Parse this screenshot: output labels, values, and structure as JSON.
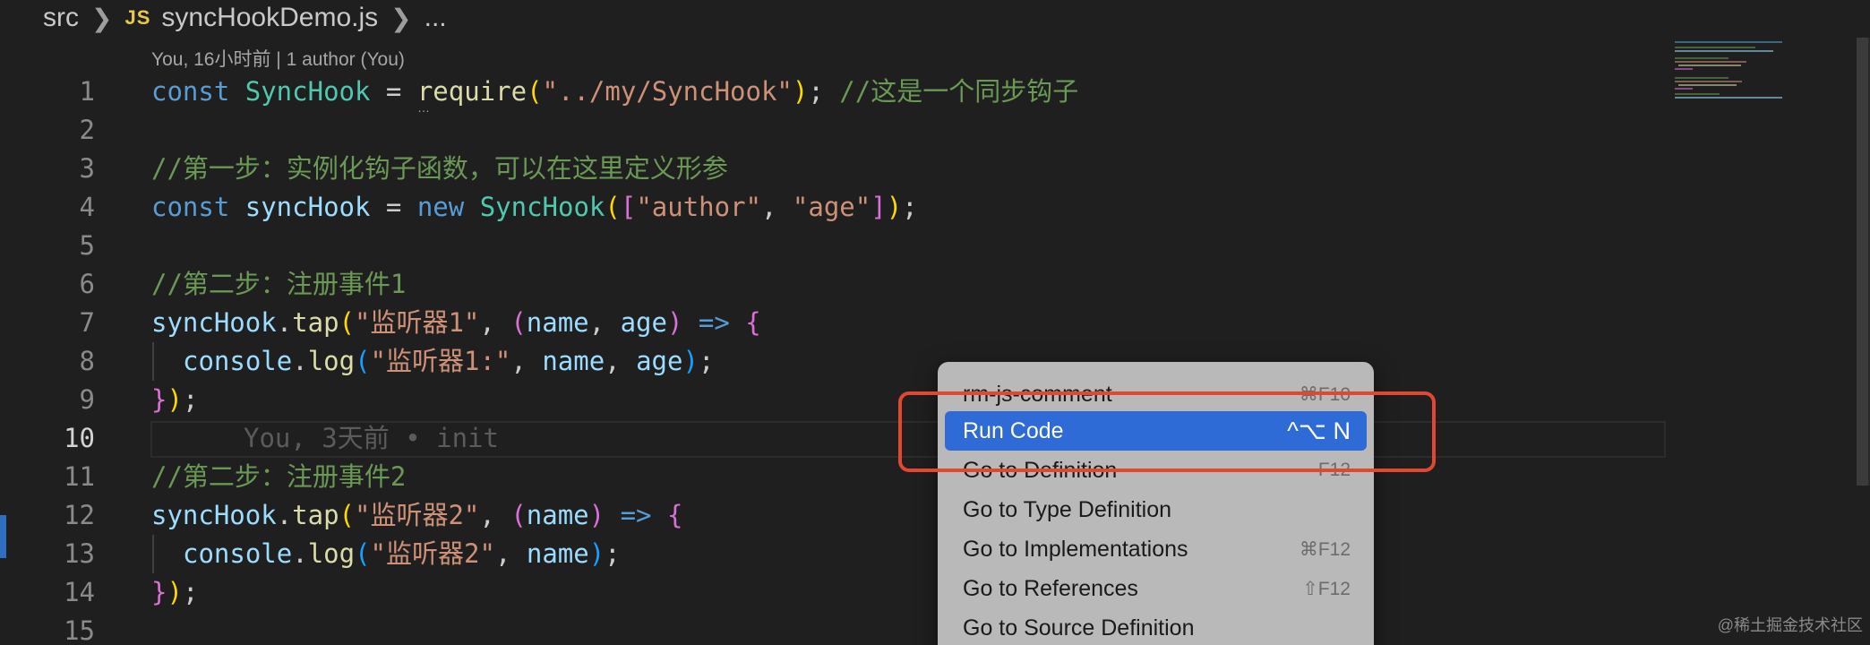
{
  "breadcrumb": {
    "folder": "src",
    "file_icon": "JS",
    "file": "syncHookDemo.js",
    "more": "..."
  },
  "blame_header": "You, 16小时前 | 1 author (You)",
  "editor": {
    "line_numbers": [
      "1",
      "2",
      "3",
      "4",
      "5",
      "6",
      "7",
      "8",
      "9",
      "10",
      "11",
      "12",
      "13",
      "14",
      "15"
    ],
    "active_line": "10",
    "lines": {
      "l1": {
        "t1": "const ",
        "t2": "SyncHook",
        "t3": " = ",
        "t4": "require",
        "t5": "(",
        "t6": "\"../my/SyncHook\"",
        "t7": ")",
        "t8": "; ",
        "t9": "//这是一个同步钩子"
      },
      "l3": {
        "t1": "//第一步：实例化钩子函数，可以在这里定义形参"
      },
      "l4": {
        "t1": "const ",
        "t2": "syncHook",
        "t3": " = ",
        "t4": "new ",
        "t5": "SyncHook",
        "t6": "(",
        "t7": "[",
        "t8": "\"author\"",
        "t9": ", ",
        "t10": "\"age\"",
        "t11": "]",
        "t12": ")",
        "t13": ";"
      },
      "l6": {
        "t1": "//第二步：注册事件1"
      },
      "l7": {
        "t1": "syncHook",
        "t2": ".",
        "t3": "tap",
        "t4": "(",
        "t5": "\"监听器1\"",
        "t6": ", ",
        "t7": "(",
        "t8": "name",
        "t9": ", ",
        "t10": "age",
        "t11": ")",
        "t12": " => ",
        "t13": "{"
      },
      "l8": {
        "t1": "console",
        "t2": ".",
        "t3": "log",
        "t4": "(",
        "t5": "\"监听器1:\"",
        "t6": ", ",
        "t7": "name",
        "t8": ", ",
        "t9": "age",
        "t10": ")",
        "t11": ";"
      },
      "l9": {
        "t1": "}",
        "t2": ")",
        "t3": ";"
      },
      "l10": {
        "blame": "You, 3天前 • init"
      },
      "l11": {
        "t1": "//第二步：注册事件2"
      },
      "l12": {
        "t1": "syncHook",
        "t2": ".",
        "t3": "tap",
        "t4": "(",
        "t5": "\"监听器2\"",
        "t6": ", ",
        "t7": "(",
        "t8": "name",
        "t9": ")",
        "t10": " => ",
        "t11": "{"
      },
      "l13": {
        "t1": "console",
        "t2": ".",
        "t3": "log",
        "t4": "(",
        "t5": "\"监听器2\"",
        "t6": ", ",
        "t7": "name",
        "t8": ")",
        "t9": ";"
      },
      "l14": {
        "t1": "}",
        "t2": ")",
        "t3": ";"
      }
    }
  },
  "context_menu": {
    "items": [
      {
        "label": "rm-js-comment",
        "shortcut": "⌘F10"
      },
      {
        "label": "Run Code",
        "shortcut": "^⌥ N"
      },
      {
        "label": "Go to Definition",
        "shortcut": "F12"
      },
      {
        "label": "Go to Type Definition",
        "shortcut": ""
      },
      {
        "label": "Go to Implementations",
        "shortcut": "⌘F12"
      },
      {
        "label": "Go to References",
        "shortcut": "⇧F12"
      },
      {
        "label": "Go to Source Definition",
        "shortcut": ""
      }
    ],
    "selected_index": 1
  },
  "watermark": "@稀土掘金技术社区",
  "colors": {
    "background": "#1f1f1f",
    "menu_background": "#b9b9b9",
    "menu_selected": "#2e6bd6",
    "annotation_red": "#e2472f"
  }
}
